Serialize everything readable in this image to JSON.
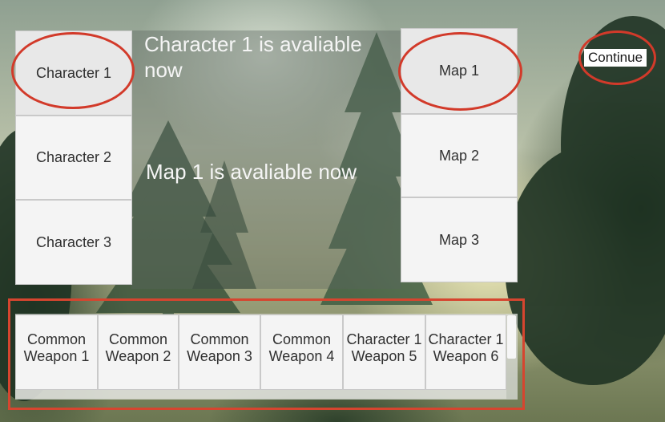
{
  "characters": [
    {
      "label": "Character 1",
      "selected": true
    },
    {
      "label": "Character 2",
      "selected": false
    },
    {
      "label": "Character 3",
      "selected": false
    }
  ],
  "maps": [
    {
      "label": "Map 1",
      "selected": true
    },
    {
      "label": "Map 2",
      "selected": false
    },
    {
      "label": "Map 3",
      "selected": false
    }
  ],
  "notices": {
    "character": "Character 1 is avaliable now",
    "map": "Map 1 is avaliable now"
  },
  "weapons": [
    {
      "line1": "Common",
      "line2": "Weapon 1"
    },
    {
      "line1": "Common",
      "line2": "Weapon 2"
    },
    {
      "line1": "Common",
      "line2": "Weapon 3"
    },
    {
      "line1": "Common",
      "line2": "Weapon 4"
    },
    {
      "line1": "Character 1",
      "line2": "Weapon 5"
    },
    {
      "line1": "Character 1",
      "line2": "Weapon 6"
    }
  ],
  "continue_label": "Continue",
  "colors": {
    "highlight": "#d23a2a",
    "button_bg": "#f4f4f4",
    "text_light": "#f5f5f5"
  }
}
